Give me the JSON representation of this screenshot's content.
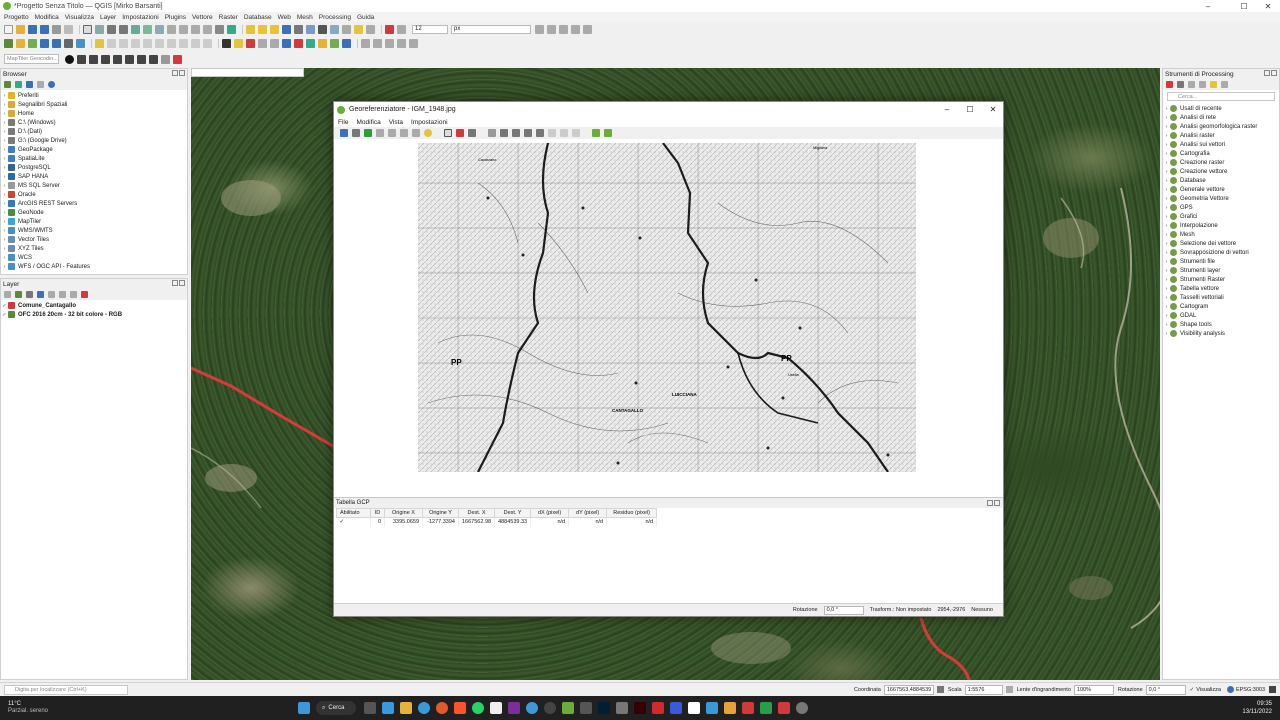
{
  "app": {
    "window_title": "*Progetto Senza Titolo — QGIS [Mirko Barsanti]",
    "menu": [
      "Progetto",
      "Modifica",
      "Visualizza",
      "Layer",
      "Impostazioni",
      "Plugins",
      "Vettore",
      "Raster",
      "Database",
      "Web",
      "Mesh",
      "Processing",
      "Guida"
    ],
    "font_size_value": "12",
    "font_unit": "px",
    "geocoder_placeholder": "MapTiler Geocodin..."
  },
  "browser": {
    "title": "Browser",
    "items": [
      {
        "label": "Preferiti",
        "icon": "star-icon",
        "color": "#e9b51d"
      },
      {
        "label": "Segnalibri Spaziali",
        "icon": "bookmark-folder-icon",
        "color": "#d9a93a"
      },
      {
        "label": "Home",
        "icon": "folder-icon",
        "color": "#d9a93a"
      },
      {
        "label": "C:\\ (Windows)",
        "icon": "drive-icon",
        "color": "#7a7a7a"
      },
      {
        "label": "D:\\ (Dati)",
        "icon": "drive-icon",
        "color": "#7a7a7a"
      },
      {
        "label": "G:\\ (Google Drive)",
        "icon": "drive-icon",
        "color": "#7a7a7a"
      },
      {
        "label": "GeoPackage",
        "icon": "geopackage-icon",
        "color": "#3f7fbf"
      },
      {
        "label": "SpatiaLite",
        "icon": "spatialite-icon",
        "color": "#3f7fbf"
      },
      {
        "label": "PostgreSQL",
        "icon": "postgresql-icon",
        "color": "#336791"
      },
      {
        "label": "SAP HANA",
        "icon": "sap-hana-icon",
        "color": "#2a6ab3"
      },
      {
        "label": "MS SQL Server",
        "icon": "mssql-icon",
        "color": "#9b9b9b"
      },
      {
        "label": "Oracle",
        "icon": "oracle-icon",
        "color": "#c74634"
      },
      {
        "label": "ArcGIS REST Servers",
        "icon": "arcgis-icon",
        "color": "#2f7bbf"
      },
      {
        "label": "GeoNode",
        "icon": "geonode-icon",
        "color": "#4a8f3a"
      },
      {
        "label": "MapTiler",
        "icon": "maptiler-icon",
        "color": "#3aa6d8"
      },
      {
        "label": "WMS/WMTS",
        "icon": "globe-icon",
        "color": "#4a90c8"
      },
      {
        "label": "Vector Tiles",
        "icon": "vector-tiles-icon",
        "color": "#6a8fb5"
      },
      {
        "label": "XYZ Tiles",
        "icon": "xyz-tiles-icon",
        "color": "#6a8fb5"
      },
      {
        "label": "WCS",
        "icon": "globe-icon",
        "color": "#4a90c8"
      },
      {
        "label": "WFS / OGC API - Features",
        "icon": "globe-icon",
        "color": "#4a90c8"
      }
    ]
  },
  "layers": {
    "title": "Layer",
    "items": [
      {
        "label": "Comune_Cantagallo",
        "checked": true,
        "icon": "polygon-layer-icon",
        "color": "#d03a3a"
      },
      {
        "label": "OFC 2016 20cm - 32 bit colore - RGB",
        "checked": true,
        "icon": "raster-layer-icon",
        "color": "#5b8a3a"
      }
    ]
  },
  "processing": {
    "title": "Strumenti di Processing",
    "search_placeholder": "Cerca...",
    "items": [
      {
        "label": "Usati di recente",
        "icon": "clock-icon"
      },
      {
        "label": "Analisi di rete",
        "icon": "qgis-icon"
      },
      {
        "label": "Analisi geomorfologica raster",
        "icon": "qgis-icon"
      },
      {
        "label": "Analisi raster",
        "icon": "qgis-icon"
      },
      {
        "label": "Analisi sui vettori",
        "icon": "qgis-icon"
      },
      {
        "label": "Cartografia",
        "icon": "qgis-icon"
      },
      {
        "label": "Creazione raster",
        "icon": "qgis-icon"
      },
      {
        "label": "Creazione vettore",
        "icon": "qgis-icon"
      },
      {
        "label": "Database",
        "icon": "qgis-icon"
      },
      {
        "label": "Generale vettore",
        "icon": "qgis-icon"
      },
      {
        "label": "Geometria Vettore",
        "icon": "qgis-icon"
      },
      {
        "label": "GPS",
        "icon": "qgis-icon"
      },
      {
        "label": "Grafici",
        "icon": "qgis-icon"
      },
      {
        "label": "Interpolazione",
        "icon": "qgis-icon"
      },
      {
        "label": "Mesh",
        "icon": "qgis-icon"
      },
      {
        "label": "Selezione dei vettore",
        "icon": "qgis-icon"
      },
      {
        "label": "Sovrapposizione di vettori",
        "icon": "qgis-icon"
      },
      {
        "label": "Strumenti file",
        "icon": "qgis-icon"
      },
      {
        "label": "Strumenti layer",
        "icon": "qgis-icon"
      },
      {
        "label": "Strumenti Raster",
        "icon": "qgis-icon"
      },
      {
        "label": "Tabella vettore",
        "icon": "qgis-icon"
      },
      {
        "label": "Tasselli vettoriali",
        "icon": "qgis-icon"
      },
      {
        "label": "Cartogram",
        "icon": "cartogram-icon"
      },
      {
        "label": "GDAL",
        "icon": "gdal-icon"
      },
      {
        "label": "Shape tools",
        "icon": "star-icon"
      },
      {
        "label": "Visibility analysis",
        "icon": "eye-icon"
      }
    ]
  },
  "georef": {
    "title": "Georeferenziatore - IGM_1948.jpg",
    "menu": [
      "File",
      "Modifica",
      "Vista",
      "Impostazioni"
    ],
    "map_labels": [
      "PP",
      "PP",
      "CANTAGALLO",
      "LUICCIANA",
      "Cavarzano",
      "Migliana",
      "Usella"
    ],
    "gcp_title": "Tabella GCP",
    "columns": [
      "Abilitato",
      "ID",
      "Origine X",
      "Origine Y",
      "Dest. X",
      "Dest. Y",
      "dX (pixel)",
      "dY (pixel)",
      "Residuo (pixel)"
    ],
    "rows": [
      {
        "enabled": "✓",
        "id": "0",
        "src_x": "3395.0659",
        "src_y": "-1277.3394",
        "dst_x": "1667562.98",
        "dst_y": "4884539.33",
        "dx": "n/d",
        "dy": "n/d",
        "res": "n/d"
      }
    ],
    "status": {
      "rotation_label": "Rotazione",
      "rotation_value": "0,0 °",
      "transform": "Trasform.: Non impostato",
      "coords": "2954,-2976",
      "crs": "Nessuno"
    }
  },
  "statusbar": {
    "locator_placeholder": "Digita per localizzare (Ctrl+K)",
    "coord_label": "Coordinata",
    "coord_value": "1667563,4884539",
    "scale_label": "Scala",
    "scale_value": "1:5576",
    "magnifier_label": "Lente d'ingrandimento",
    "magnifier_value": "100%",
    "rotation_label": "Rotazione",
    "rotation_value": "0,0 °",
    "render_label": "Visualizza",
    "crs": "EPSG:3003"
  },
  "taskbar": {
    "temp": "11°C",
    "weather": "Parzial. sereno",
    "search_label": "Cerca",
    "time": "09:35",
    "date": "13/11/2022"
  }
}
